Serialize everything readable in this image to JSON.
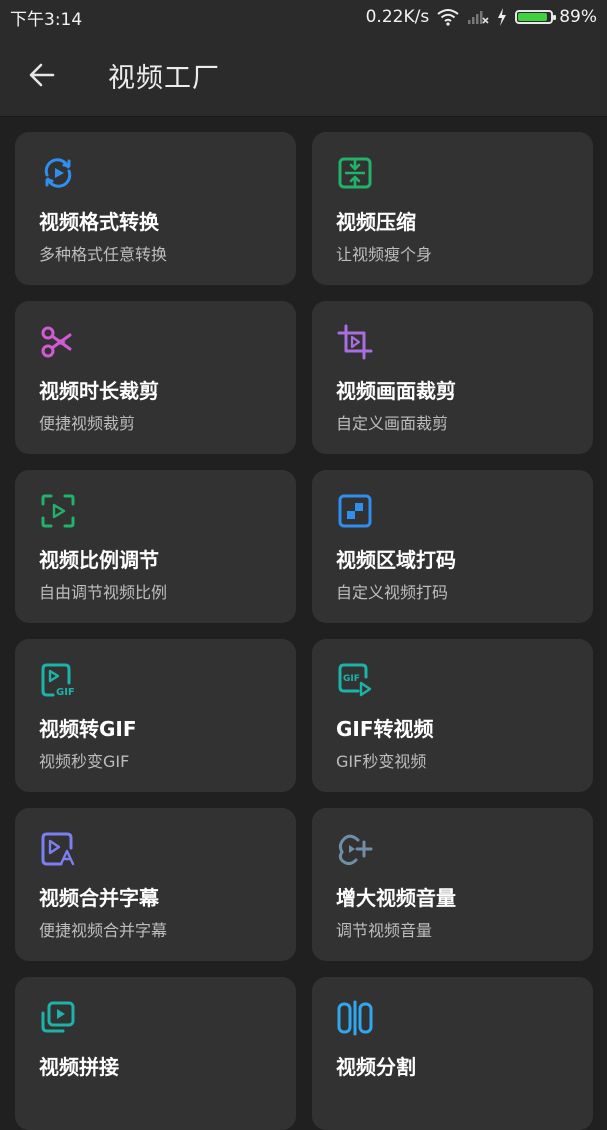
{
  "status_bar": {
    "time": "下午3:14",
    "network_speed": "0.22K/s",
    "battery_percent": "89%",
    "battery_level": 0.89,
    "icons": [
      "wifi-icon",
      "signal-no-service-icon",
      "charging-bolt-icon",
      "battery-icon"
    ]
  },
  "app_bar": {
    "back_icon": "arrow-left-icon",
    "title": "视频工厂"
  },
  "colors": {
    "background": "#202020",
    "card": "#323232",
    "blue": "#2f8ff0",
    "green": "#22b36a",
    "purple": "#a86fe0",
    "teal": "#1cb3a8",
    "indigo": "#7b7ff2",
    "slate": "#6e8fa6"
  },
  "tools": [
    {
      "title": "视频格式转换",
      "subtitle": "多种格式任意转换",
      "icon": "video-convert-icon"
    },
    {
      "title": "视频压缩",
      "subtitle": "让视频瘦个身",
      "icon": "video-compress-icon"
    },
    {
      "title": "视频时长裁剪",
      "subtitle": "便捷视频裁剪",
      "icon": "scissors-icon"
    },
    {
      "title": "视频画面裁剪",
      "subtitle": "自定义画面裁剪",
      "icon": "crop-icon"
    },
    {
      "title": "视频比例调节",
      "subtitle": "自由调节视频比例",
      "icon": "aspect-ratio-icon"
    },
    {
      "title": "视频区域打码",
      "subtitle": "自定义视频打码",
      "icon": "mosaic-icon"
    },
    {
      "title": "视频转GIF",
      "subtitle": "视频秒变GIF",
      "icon": "video-to-gif-icon",
      "icon_text": "GIF"
    },
    {
      "title": "GIF转视频",
      "subtitle": "GIF秒变视频",
      "icon": "gif-to-video-icon",
      "icon_text": "GIF"
    },
    {
      "title": "视频合并字幕",
      "subtitle": "便捷视频合并字幕",
      "icon": "subtitle-icon"
    },
    {
      "title": "增大视频音量",
      "subtitle": "调节视频音量",
      "icon": "volume-boost-icon"
    },
    {
      "title": "视频拼接",
      "subtitle": "",
      "icon": "video-merge-icon"
    },
    {
      "title": "视频分割",
      "subtitle": "",
      "icon": "video-split-icon"
    }
  ]
}
